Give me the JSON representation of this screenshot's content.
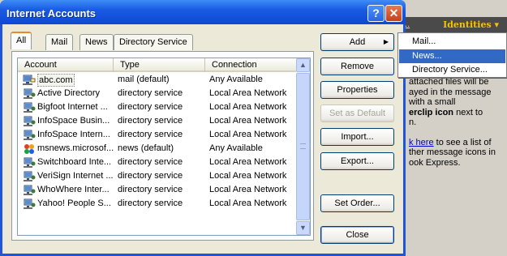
{
  "window": {
    "title": "Internet Accounts",
    "help_label": "?",
    "close_label": "✕"
  },
  "tabs": [
    "All",
    "Mail",
    "News",
    "Directory Service"
  ],
  "list": {
    "columns": [
      "Account",
      "Type",
      "Connection"
    ],
    "rows": [
      {
        "icon": "news-server-icon",
        "account": "abc.com",
        "type": "mail (default)",
        "connection": "Any Available"
      },
      {
        "icon": "directory-service-icon",
        "account": "Active Directory",
        "type": "directory service",
        "connection": "Local Area Network"
      },
      {
        "icon": "directory-service-icon",
        "account": "Bigfoot Internet ...",
        "type": "directory service",
        "connection": "Local Area Network"
      },
      {
        "icon": "directory-service-icon",
        "account": "InfoSpace Busin...",
        "type": "directory service",
        "connection": "Local Area Network"
      },
      {
        "icon": "directory-service-icon",
        "account": "InfoSpace Intern...",
        "type": "directory service",
        "connection": "Local Area Network"
      },
      {
        "icon": "msn-news-icon",
        "account": "msnews.microsof...",
        "type": "news (default)",
        "connection": "Any Available"
      },
      {
        "icon": "directory-service-icon",
        "account": "Switchboard Inte...",
        "type": "directory service",
        "connection": "Local Area Network"
      },
      {
        "icon": "directory-service-icon",
        "account": "VeriSign Internet ...",
        "type": "directory service",
        "connection": "Local Area Network"
      },
      {
        "icon": "directory-service-icon",
        "account": "WhoWhere Inter...",
        "type": "directory service",
        "connection": "Local Area Network"
      },
      {
        "icon": "directory-service-icon",
        "account": "Yahoo! People S...",
        "type": "directory service",
        "connection": "Local Area Network"
      }
    ]
  },
  "buttons": {
    "add": "Add",
    "remove": "Remove",
    "properties": "Properties",
    "set_default": "Set as Default",
    "import": "Import...",
    "export": "Export...",
    "set_order": "Set Order...",
    "close": "Close"
  },
  "add_menu": {
    "items": [
      "Mail...",
      "News...",
      "Directory Service..."
    ],
    "selected": "News..."
  },
  "background": {
    "nav_dots": "...",
    "identities_label": "Identities ▾",
    "text_line1": "attached files will be",
    "text_line2": "ayed in the message",
    "text_line3": "with a small",
    "text_line4": "erclip icon",
    "text_line4b": " next to",
    "text_line5": "n.",
    "link_text": "k here",
    "text_line6": " to see a list of",
    "text_line7": "ther message icons in",
    "text_line8": "ook Express."
  },
  "colors": {
    "title_bar": "#0d49d4",
    "menu_highlight": "#316ac5",
    "active_tab_accent": "#e68b2c",
    "identities_text": "#f5c400"
  }
}
